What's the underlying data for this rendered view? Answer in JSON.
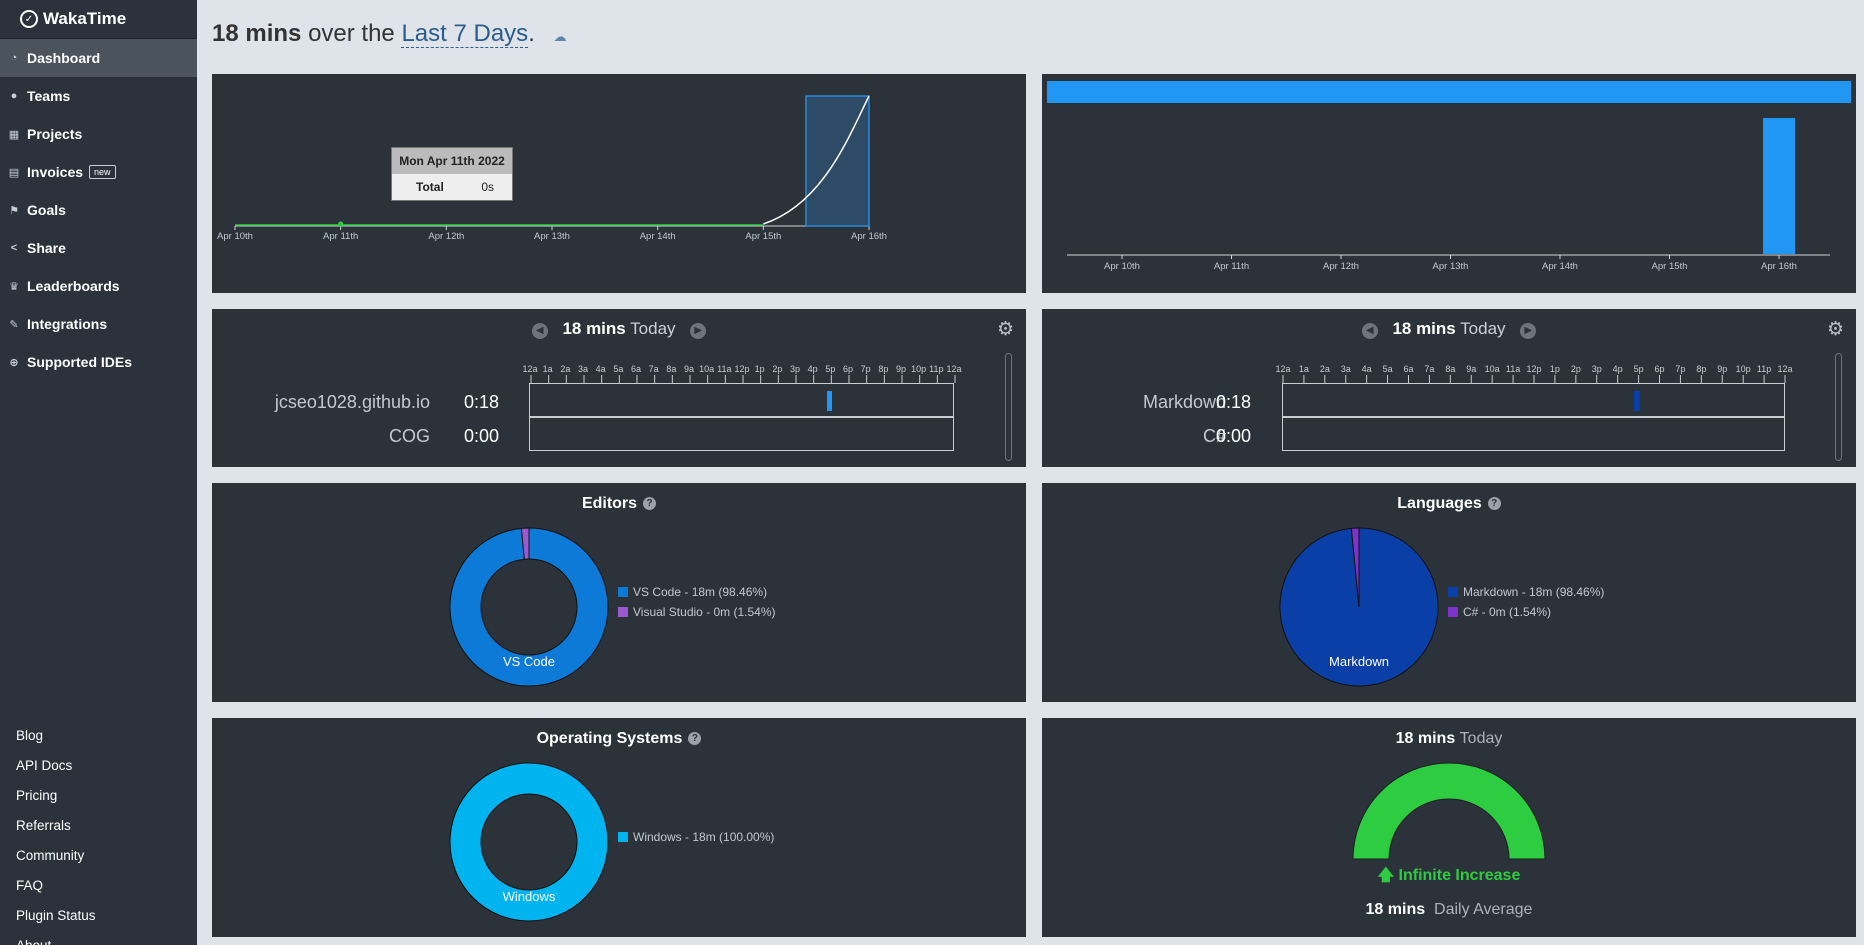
{
  "brand": {
    "name": "WakaTime"
  },
  "sidebar": {
    "items": [
      {
        "label": "Dashboard",
        "icon": "dashboard-icon"
      },
      {
        "label": "Teams",
        "icon": "users-icon"
      },
      {
        "label": "Projects",
        "icon": "grid-icon"
      },
      {
        "label": "Invoices",
        "icon": "invoice-icon",
        "badge": "new"
      },
      {
        "label": "Goals",
        "icon": "flag-icon"
      },
      {
        "label": "Share",
        "icon": "share-icon"
      },
      {
        "label": "Leaderboards",
        "icon": "trophy-icon"
      },
      {
        "label": "Integrations",
        "icon": "wrench-icon"
      },
      {
        "label": "Supported IDEs",
        "icon": "plus-circle-icon"
      }
    ],
    "footer": [
      "Blog",
      "API Docs",
      "Pricing",
      "Referrals",
      "Community",
      "FAQ",
      "Plugin Status",
      "About"
    ]
  },
  "header": {
    "total": "18 mins",
    "over_the": "over the",
    "range": "Last 7 Days",
    "period": "."
  },
  "activity_chart": {
    "tooltip": {
      "date": "Mon Apr 11th 2022",
      "label": "Total",
      "value": "0s"
    },
    "x_labels": [
      "Apr 10th",
      "Apr 11th",
      "Apr 12th",
      "Apr 13th",
      "Apr 14th",
      "Apr 15th",
      "Apr 16th"
    ]
  },
  "projects_timeline": {
    "total": "18 mins",
    "period": "Today",
    "rows": [
      {
        "name": "jcseo1028.github.io",
        "time": "0:18"
      },
      {
        "name": "COG",
        "time": "0:00"
      }
    ]
  },
  "languages_timeline": {
    "total": "18 mins",
    "period": "Today",
    "rows": [
      {
        "name": "Markdown",
        "time": "0:18"
      },
      {
        "name": "C#",
        "time": "0:00"
      }
    ]
  },
  "hour_ticks": [
    "12a",
    "1a",
    "2a",
    "3a",
    "4a",
    "5a",
    "6a",
    "7a",
    "8a",
    "9a",
    "10a",
    "11a",
    "12p",
    "1p",
    "2p",
    "3p",
    "4p",
    "5p",
    "6p",
    "7p",
    "8p",
    "9p",
    "10p",
    "11p",
    "12a"
  ],
  "editors": {
    "title": "Editors",
    "legend": [
      "VS Code - 18m (98.46%)",
      "Visual Studio - 0m (1.54%)"
    ],
    "center_label": "VS Code",
    "colors": [
      "#0c7ad6",
      "#9b59d0"
    ]
  },
  "languages": {
    "title": "Languages",
    "legend": [
      "Markdown - 18m (98.46%)",
      "C# - 0m (1.54%)"
    ],
    "center_label": "Markdown",
    "colors": [
      "#0b3fa8",
      "#7b33c9"
    ]
  },
  "os": {
    "title": "Operating Systems",
    "legend": [
      "Windows - 18m (100.00%)"
    ],
    "center_label": "Windows",
    "colors": [
      "#00b4ef"
    ]
  },
  "today_gauge": {
    "total": "18 mins",
    "period": "Today",
    "increase": "Infinite Increase",
    "daily_total": "18 mins",
    "daily_label": "Daily Average",
    "color": "#2ecc40"
  },
  "chart_data": [
    {
      "type": "area",
      "x": [
        "Apr 10th",
        "Apr 11th",
        "Apr 12th",
        "Apr 13th",
        "Apr 14th",
        "Apr 15th",
        "Apr 16th"
      ],
      "series": [
        {
          "values": [
            0,
            0,
            0,
            0,
            0,
            0,
            18
          ]
        }
      ]
    },
    {
      "type": "bar",
      "categories": [
        "Apr 10th",
        "Apr 11th",
        "Apr 12th",
        "Apr 13th",
        "Apr 14th",
        "Apr 15th",
        "Apr 16th"
      ],
      "values": [
        0,
        0,
        0,
        0,
        0,
        0,
        18
      ]
    },
    {
      "type": "pie",
      "title": "Editors",
      "categories": [
        "VS Code",
        "Visual Studio"
      ],
      "values": [
        98.46,
        1.54
      ]
    },
    {
      "type": "pie",
      "title": "Languages",
      "categories": [
        "Markdown",
        "C#"
      ],
      "values": [
        98.46,
        1.54
      ]
    },
    {
      "type": "pie",
      "title": "Operating Systems",
      "categories": [
        "Windows"
      ],
      "values": [
        100.0
      ]
    }
  ]
}
